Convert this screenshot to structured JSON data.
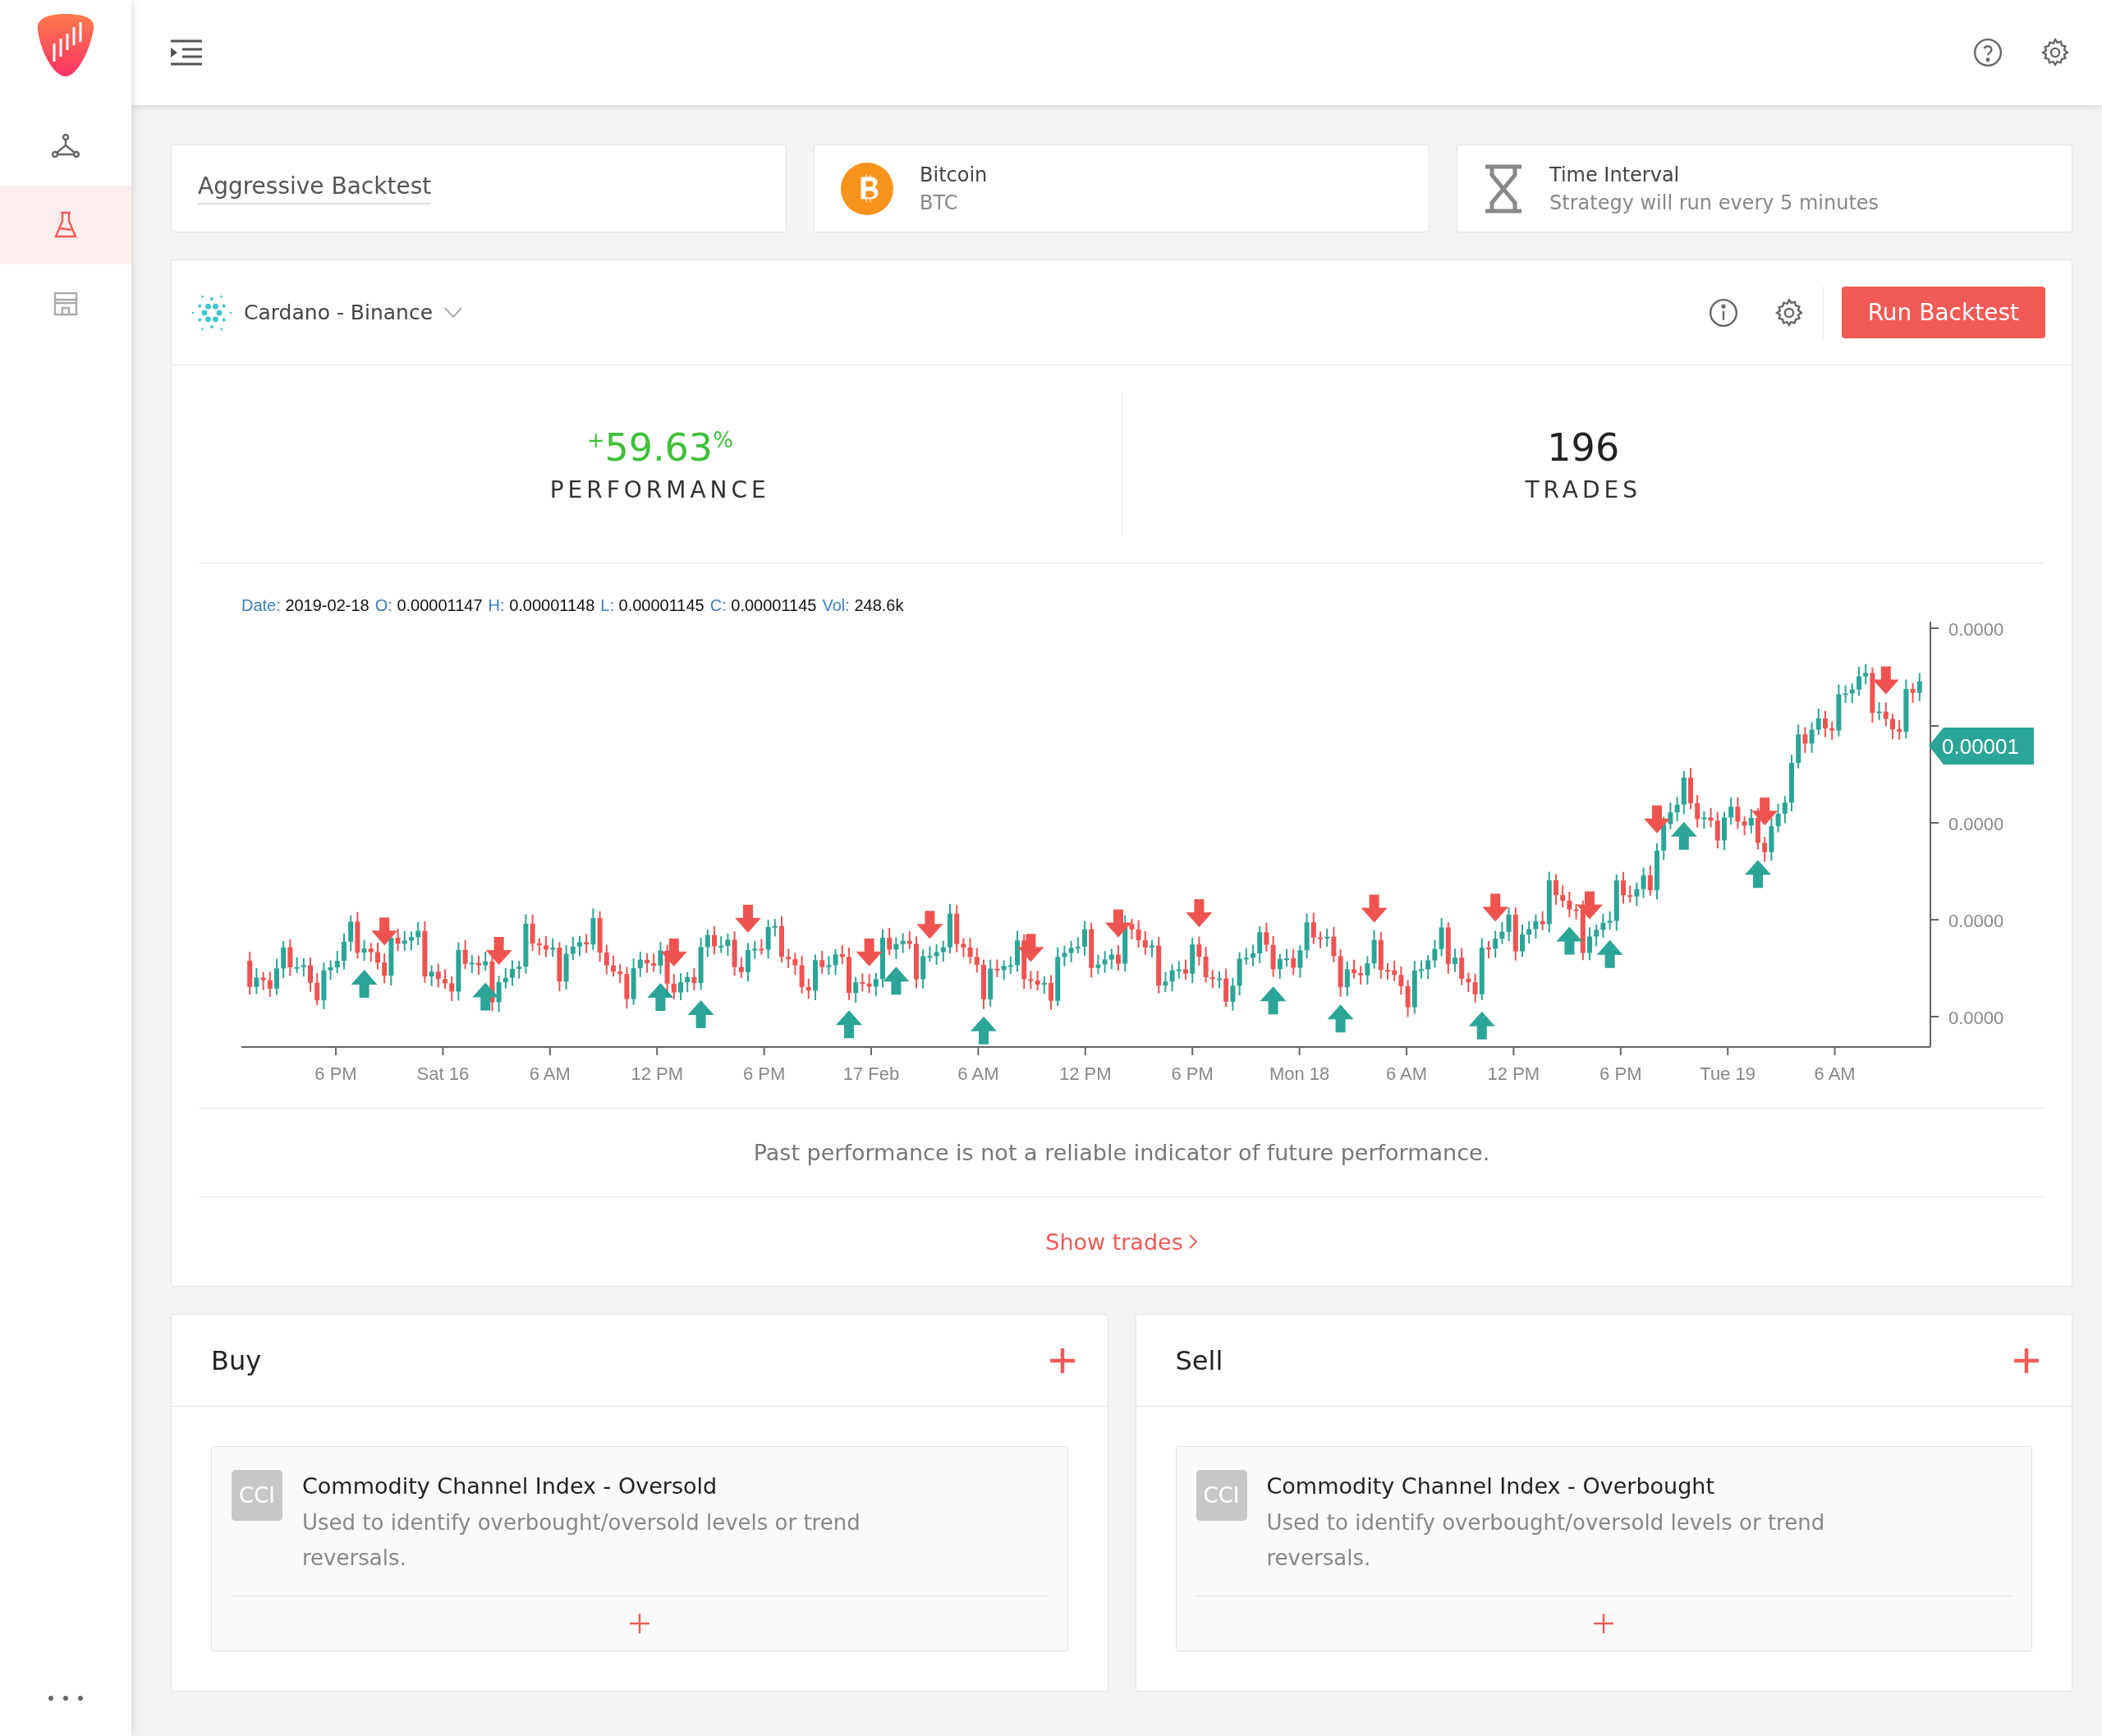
{
  "sidebar": {
    "items": [
      {
        "kind": "network",
        "selected": false
      },
      {
        "kind": "flask",
        "selected": true
      },
      {
        "kind": "store",
        "selected": false
      }
    ]
  },
  "strategy_name": "Aggressive Backtest",
  "asset": {
    "name": "Bitcoin",
    "symbol": "BTC"
  },
  "interval": {
    "title": "Time Interval",
    "description": "Strategy will run every 5 minutes"
  },
  "backtest": {
    "market": "Cardano - Binance",
    "run_button": "Run Backtest",
    "stats": [
      {
        "value": "$^{+}$59.63$^{%}$",
        "label": "PERFORMANCE",
        "kind": "positive"
      },
      {
        "value": "196",
        "label": "TRADES",
        "kind": "neutral"
      }
    ],
    "chart": {
      "ohlc": [
        {
          "key": "Date:",
          "value": "2019-02-18"
        },
        {
          "key": "O:",
          "value": "0.00001147"
        },
        {
          "key": "H:",
          "value": "0.00001148"
        },
        {
          "key": "L:",
          "value": "0.00001145"
        },
        {
          "key": "C:",
          "value": "0.00001145"
        },
        {
          "key": "Vol:",
          "value": "248.6k"
        }
      ],
      "yticks": [
        "0.0000",
        "0.0000",
        "0.0000",
        "0.0000"
      ],
      "price_badge": "0.00001",
      "xticks": [
        "6 PM",
        "Sat 16",
        "6 AM",
        "12 PM",
        "6 PM",
        "17 Feb",
        "6 AM",
        "12 PM",
        "6 PM",
        "Mon 18",
        "6 AM",
        "12 PM",
        "6 PM",
        "Tue 19",
        "6 AM"
      ]
    },
    "disclaimer": "Past performance is not a reliable indicator of future performance.",
    "show_trades": "Show trades"
  },
  "panels": [
    {
      "title": "Buy",
      "conditions": [
        {
          "badge": "CCI",
          "title": "Commodity Channel Index - Oversold",
          "description": "Used to identify overbought/oversold levels or trend reversals."
        }
      ]
    },
    {
      "title": "Sell",
      "conditions": [
        {
          "badge": "CCI",
          "title": "Commodity Channel Index - Overbought",
          "description": "Used to identify overbought/oversold levels or trend reversals."
        }
      ]
    }
  ]
}
